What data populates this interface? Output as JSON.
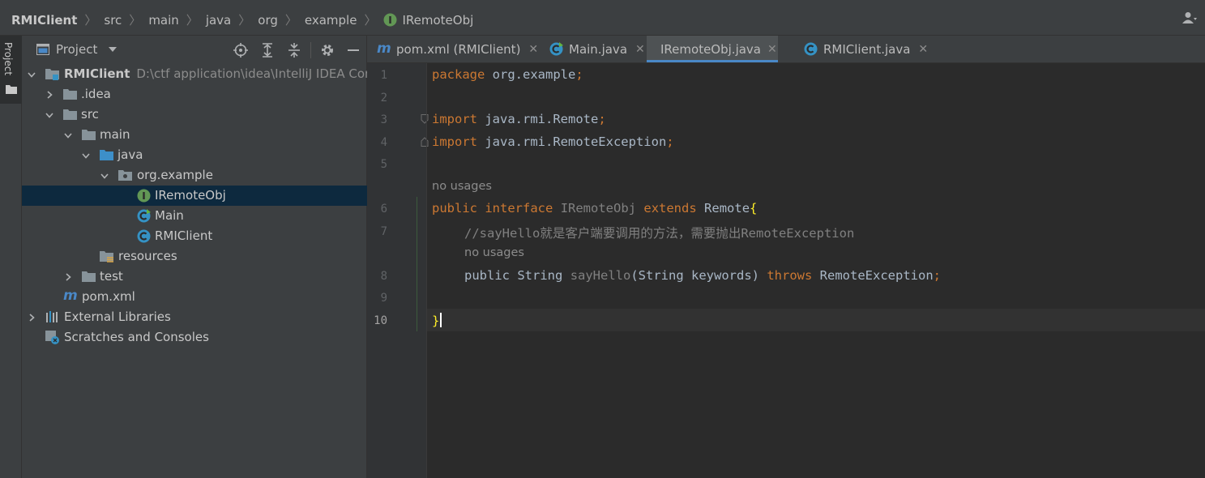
{
  "breadcrumb": [
    "RMIClient",
    "src",
    "main",
    "java",
    "org",
    "example",
    "IRemoteObj"
  ],
  "left_strip": {
    "label": "Project"
  },
  "project_panel": {
    "title": "Project",
    "tree": [
      {
        "label": "RMIClient",
        "path": "D:\\ctf application\\idea\\IntelliJ IDEA Comm",
        "icon": "module-folder-icon",
        "expanded": true
      },
      {
        "label": ".idea",
        "icon": "folder-icon",
        "expanded": false
      },
      {
        "label": "src",
        "icon": "folder-icon",
        "expanded": true
      },
      {
        "label": "main",
        "icon": "folder-icon",
        "expanded": true
      },
      {
        "label": "java",
        "icon": "source-folder-icon",
        "expanded": true
      },
      {
        "label": "org.example",
        "icon": "package-icon",
        "expanded": true
      },
      {
        "label": "IRemoteObj",
        "icon": "interface-icon",
        "selected": true
      },
      {
        "label": "Main",
        "icon": "class-main-icon"
      },
      {
        "label": "RMIClient",
        "icon": "class-icon"
      },
      {
        "label": "resources",
        "icon": "resources-folder-icon"
      },
      {
        "label": "test",
        "icon": "folder-icon",
        "expanded": false
      },
      {
        "label": "pom.xml",
        "icon": "maven-icon"
      },
      {
        "label": "External Libraries",
        "icon": "libraries-icon",
        "expanded": false
      },
      {
        "label": "Scratches and Consoles",
        "icon": "scratches-icon"
      }
    ]
  },
  "tabs": [
    {
      "label": "pom.xml (RMIClient)",
      "icon": "maven-icon",
      "active": false
    },
    {
      "label": "Main.java",
      "icon": "class-main-icon",
      "active": false
    },
    {
      "label": "IRemoteObj.java",
      "icon": "interface-icon",
      "active": true
    },
    {
      "label": "RMIClient.java",
      "icon": "class-icon",
      "active": false
    }
  ],
  "editor": {
    "line_numbers": [
      "1",
      "2",
      "3",
      "4",
      "5",
      "6",
      "7",
      "8",
      "9",
      "10"
    ],
    "current_line": "10",
    "hints": [
      "no usages",
      "no usages"
    ],
    "code": {
      "l1_kw": "package",
      "l1_rest": " org.example",
      "l1_semi": ";",
      "l3_kw": "import",
      "l3_rest": " java.rmi.Remote",
      "l3_semi": ";",
      "l4_kw": "import",
      "l4_rest": " java.rmi.RemoteException",
      "l4_semi": ";",
      "l6_kw1": "public",
      "l6_kw2": "interface",
      "l6_name": "IRemoteObj",
      "l6_kw3": "extends",
      "l6_type": "Remote",
      "l6_brace": "{",
      "l7_comment": "//sayHello就是客户端要调用的方法，需要抛出RemoteException",
      "l8_kw1": "public",
      "l8_type": "String",
      "l8_method": "sayHello",
      "l8_params": "(String keywords)",
      "l8_kw2": "throws",
      "l8_exc": "RemoteException",
      "l8_semi": ";",
      "l10_brace": "}"
    }
  },
  "colors": {
    "background": "#2b2b2b",
    "panel": "#3c3f41",
    "selection": "#0d293e",
    "keyword": "#cc7832",
    "text": "#a9b7c6",
    "comment": "#808080",
    "accent": "#4a88c7",
    "interface_icon": "#629755",
    "class_icon": "#3592c4"
  }
}
